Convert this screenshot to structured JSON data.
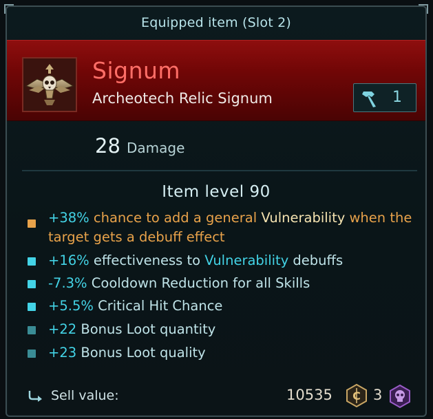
{
  "header": {
    "title": "Equipped item (Slot 2)"
  },
  "item": {
    "icon": "eagle-skull-icon",
    "name": "Signum",
    "type": "Archeotech Relic Signum",
    "rank_icon": "hammer-icon",
    "rank_value": "1"
  },
  "stats": {
    "damage_value": "28",
    "damage_label": "Damage"
  },
  "item_level": "Item level 90",
  "affixes": [
    {
      "bullet_color": "#e8a24a",
      "parts": [
        "+38%",
        " chance to add a general ",
        "Vulnerability",
        " when the target gets a debuff effect"
      ]
    },
    {
      "bullet_color": "#43d3e6",
      "parts": [
        "+16%",
        " effectiveness to ",
        "Vulnerability",
        " debuffs"
      ]
    },
    {
      "bullet_color": "#43d3e6",
      "parts": [
        "-7.3%",
        " Cooldown Reduction for all Skills"
      ]
    },
    {
      "bullet_color": "#43d3e6",
      "parts": [
        "+5.5%",
        " Critical Hit Chance"
      ]
    },
    {
      "bullet_color": "#3a8c95",
      "parts": [
        "+22",
        " Bonus Loot quantity"
      ]
    },
    {
      "bullet_color": "#3a8c95",
      "parts": [
        "+23",
        " Bonus Loot quality"
      ]
    }
  ],
  "sell": {
    "icon": "sell-arrow-icon",
    "label": "Sell value:",
    "gold_amount": "10535",
    "gold_icon": "credits-coin-icon",
    "aq_amount": "3",
    "aq_icon": "skull-hex-icon"
  },
  "colors": {
    "banner": "#8e0e0e",
    "name": "#ff6e67",
    "accent_cyan": "#43d3e6",
    "accent_gold": "#e8a24a"
  }
}
